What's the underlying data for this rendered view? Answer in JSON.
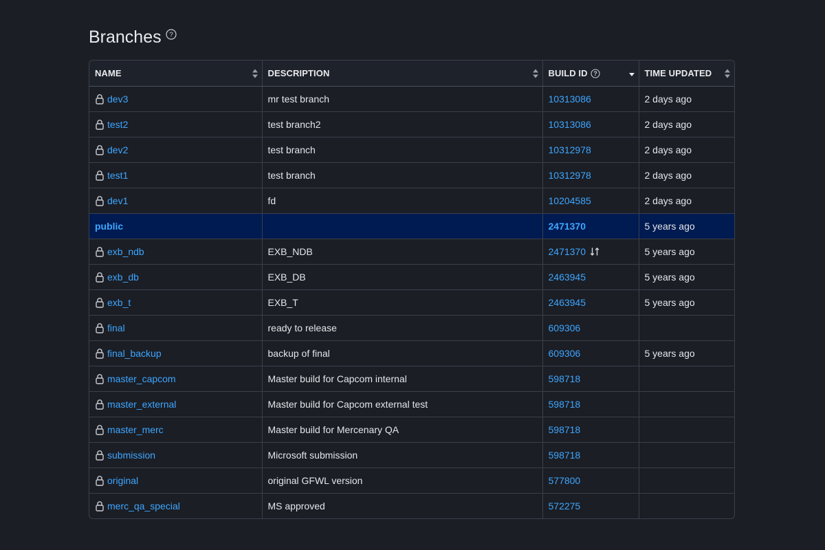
{
  "page": {
    "title": "Branches"
  },
  "table": {
    "headers": {
      "name": "NAME",
      "description": "DESCRIPTION",
      "build_id": "BUILD ID",
      "time_updated": "TIME UPDATED"
    },
    "rows": [
      {
        "name": "dev3",
        "locked": true,
        "description": "mr test branch",
        "build_id": "10313086",
        "time_updated": "2 days ago"
      },
      {
        "name": "test2",
        "locked": true,
        "description": "test branch2",
        "build_id": "10313086",
        "time_updated": "2 days ago"
      },
      {
        "name": "dev2",
        "locked": true,
        "description": "test branch",
        "build_id": "10312978",
        "time_updated": "2 days ago"
      },
      {
        "name": "test1",
        "locked": true,
        "description": "test branch",
        "build_id": "10312978",
        "time_updated": "2 days ago"
      },
      {
        "name": "dev1",
        "locked": true,
        "description": "fd",
        "build_id": "10204585",
        "time_updated": "2 days ago"
      },
      {
        "name": "public",
        "locked": false,
        "highlight": true,
        "description": "",
        "build_id": "2471370",
        "time_updated": "5 years ago"
      },
      {
        "name": "exb_ndb",
        "locked": true,
        "description": "EXB_NDB",
        "build_id": "2471370",
        "compare_icon": true,
        "time_updated": "5 years ago"
      },
      {
        "name": "exb_db",
        "locked": true,
        "description": "EXB_DB",
        "build_id": "2463945",
        "time_updated": "5 years ago"
      },
      {
        "name": "exb_t",
        "locked": true,
        "description": "EXB_T",
        "build_id": "2463945",
        "time_updated": "5 years ago"
      },
      {
        "name": "final",
        "locked": true,
        "description": "ready to release",
        "build_id": "609306",
        "time_updated": ""
      },
      {
        "name": "final_backup",
        "locked": true,
        "description": "backup of final",
        "build_id": "609306",
        "time_updated": "5 years ago"
      },
      {
        "name": "master_capcom",
        "locked": true,
        "description": "Master build for Capcom internal",
        "build_id": "598718",
        "time_updated": ""
      },
      {
        "name": "master_external",
        "locked": true,
        "description": "Master build for Capcom external test",
        "build_id": "598718",
        "time_updated": ""
      },
      {
        "name": "master_merc",
        "locked": true,
        "description": "Master build for Mercenary QA",
        "build_id": "598718",
        "time_updated": ""
      },
      {
        "name": "submission",
        "locked": true,
        "description": "Microsoft submission",
        "build_id": "598718",
        "time_updated": ""
      },
      {
        "name": "original",
        "locked": true,
        "description": "original GFWL version",
        "build_id": "577800",
        "time_updated": ""
      },
      {
        "name": "merc_qa_special",
        "locked": true,
        "description": "MS approved",
        "build_id": "572275",
        "time_updated": ""
      }
    ]
  },
  "colors": {
    "background": "#1b1e25",
    "link": "#3ea6ff",
    "highlight_row": "#001a52",
    "border": "#3a404c"
  },
  "icons": {
    "lock": "lock-icon",
    "help": "help-icon",
    "sort": "sort-icon",
    "compare": "compare-icon"
  }
}
